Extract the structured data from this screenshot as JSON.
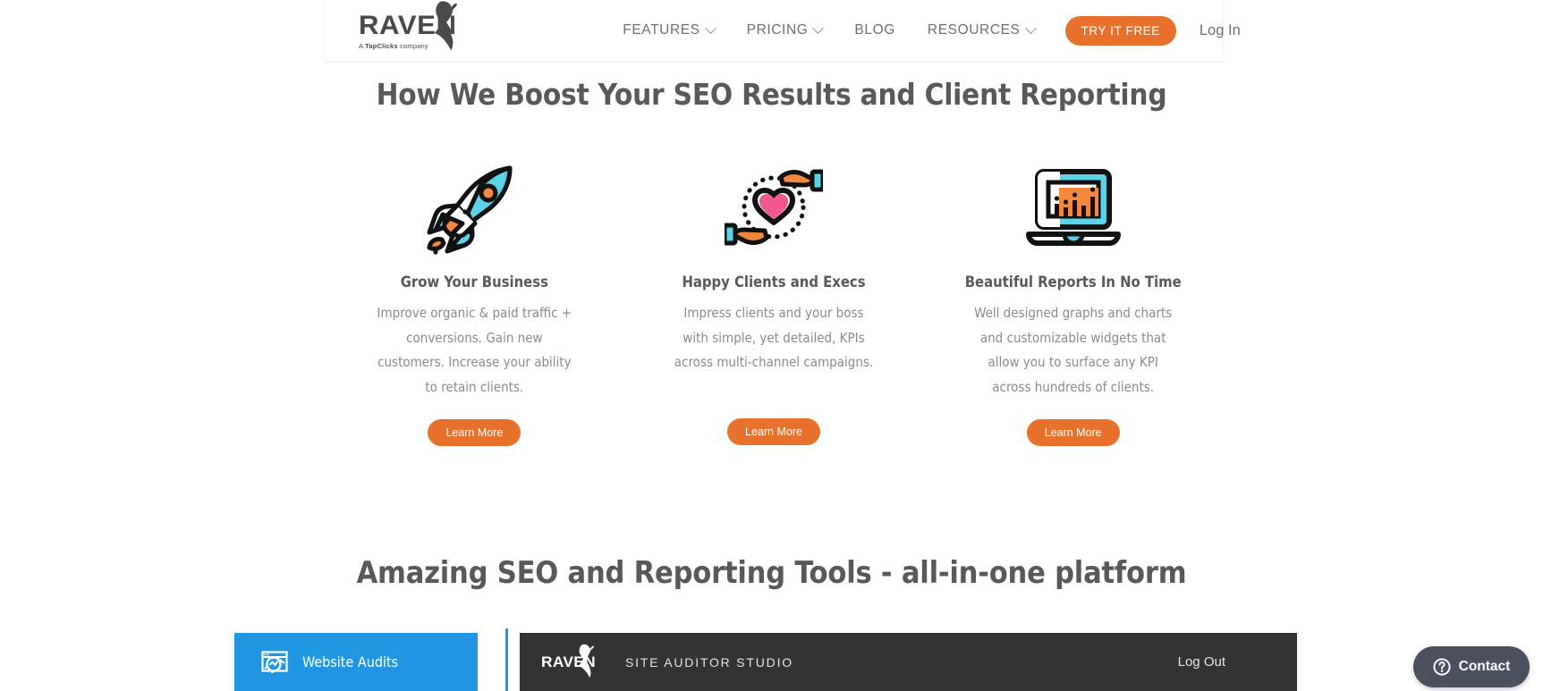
{
  "header": {
    "logo": {
      "wordmark": "RAVEN",
      "tagline_prefix": "A ",
      "tagline_brand": "TapClicks",
      "tagline_suffix": " company"
    },
    "nav": [
      {
        "label": "FEATURES",
        "has_caret": true
      },
      {
        "label": "PRICING",
        "has_caret": true
      },
      {
        "label": "BLOG",
        "has_caret": false
      },
      {
        "label": "RESOURCES",
        "has_caret": true
      }
    ],
    "cta_label": "TRY IT FREE",
    "login_label": "Log In"
  },
  "section_boost": {
    "heading": "How We Boost Your SEO Results and Client Reporting",
    "features": [
      {
        "icon": "rocket-icon",
        "title": "Grow Your Business",
        "body": "Improve organic & paid traffic + conversions. Gain new customers. Increase your ability to retain clients.",
        "button_label": "Learn More"
      },
      {
        "icon": "hands-heart-icon",
        "title": "Happy Clients and Execs",
        "body": "Impress clients and your boss with simple, yet detailed, KPIs across multi-channel campaigns.",
        "button_label": "Learn More"
      },
      {
        "icon": "laptop-chart-icon",
        "title": "Beautiful Reports In No Time",
        "body": "Well designed graphs and charts and customizable widgets that allow you to surface any KPI across hundreds of clients.",
        "button_label": "Learn More"
      }
    ]
  },
  "section_tools": {
    "heading": "Amazing SEO and Reporting Tools - all-in-one platform",
    "tabs": [
      {
        "label": "Website Audits",
        "icon": "site-audit-icon",
        "active": true
      }
    ],
    "studio": {
      "logo_wordmark": "RAVEN",
      "title": "SITE AUDITOR STUDIO",
      "logout_label": "Log Out"
    }
  },
  "contact_widget": {
    "label": "Contact",
    "icon": "question-circle-icon"
  },
  "colors": {
    "orange": "#e8722c",
    "blue": "#2196e3",
    "cyan": "#5bd2e8",
    "pink": "#f0588f",
    "dark_panel": "#333333",
    "contact_slate": "#4a505e",
    "heading_gray": "#595959",
    "body_gray": "#8b8b8b"
  }
}
